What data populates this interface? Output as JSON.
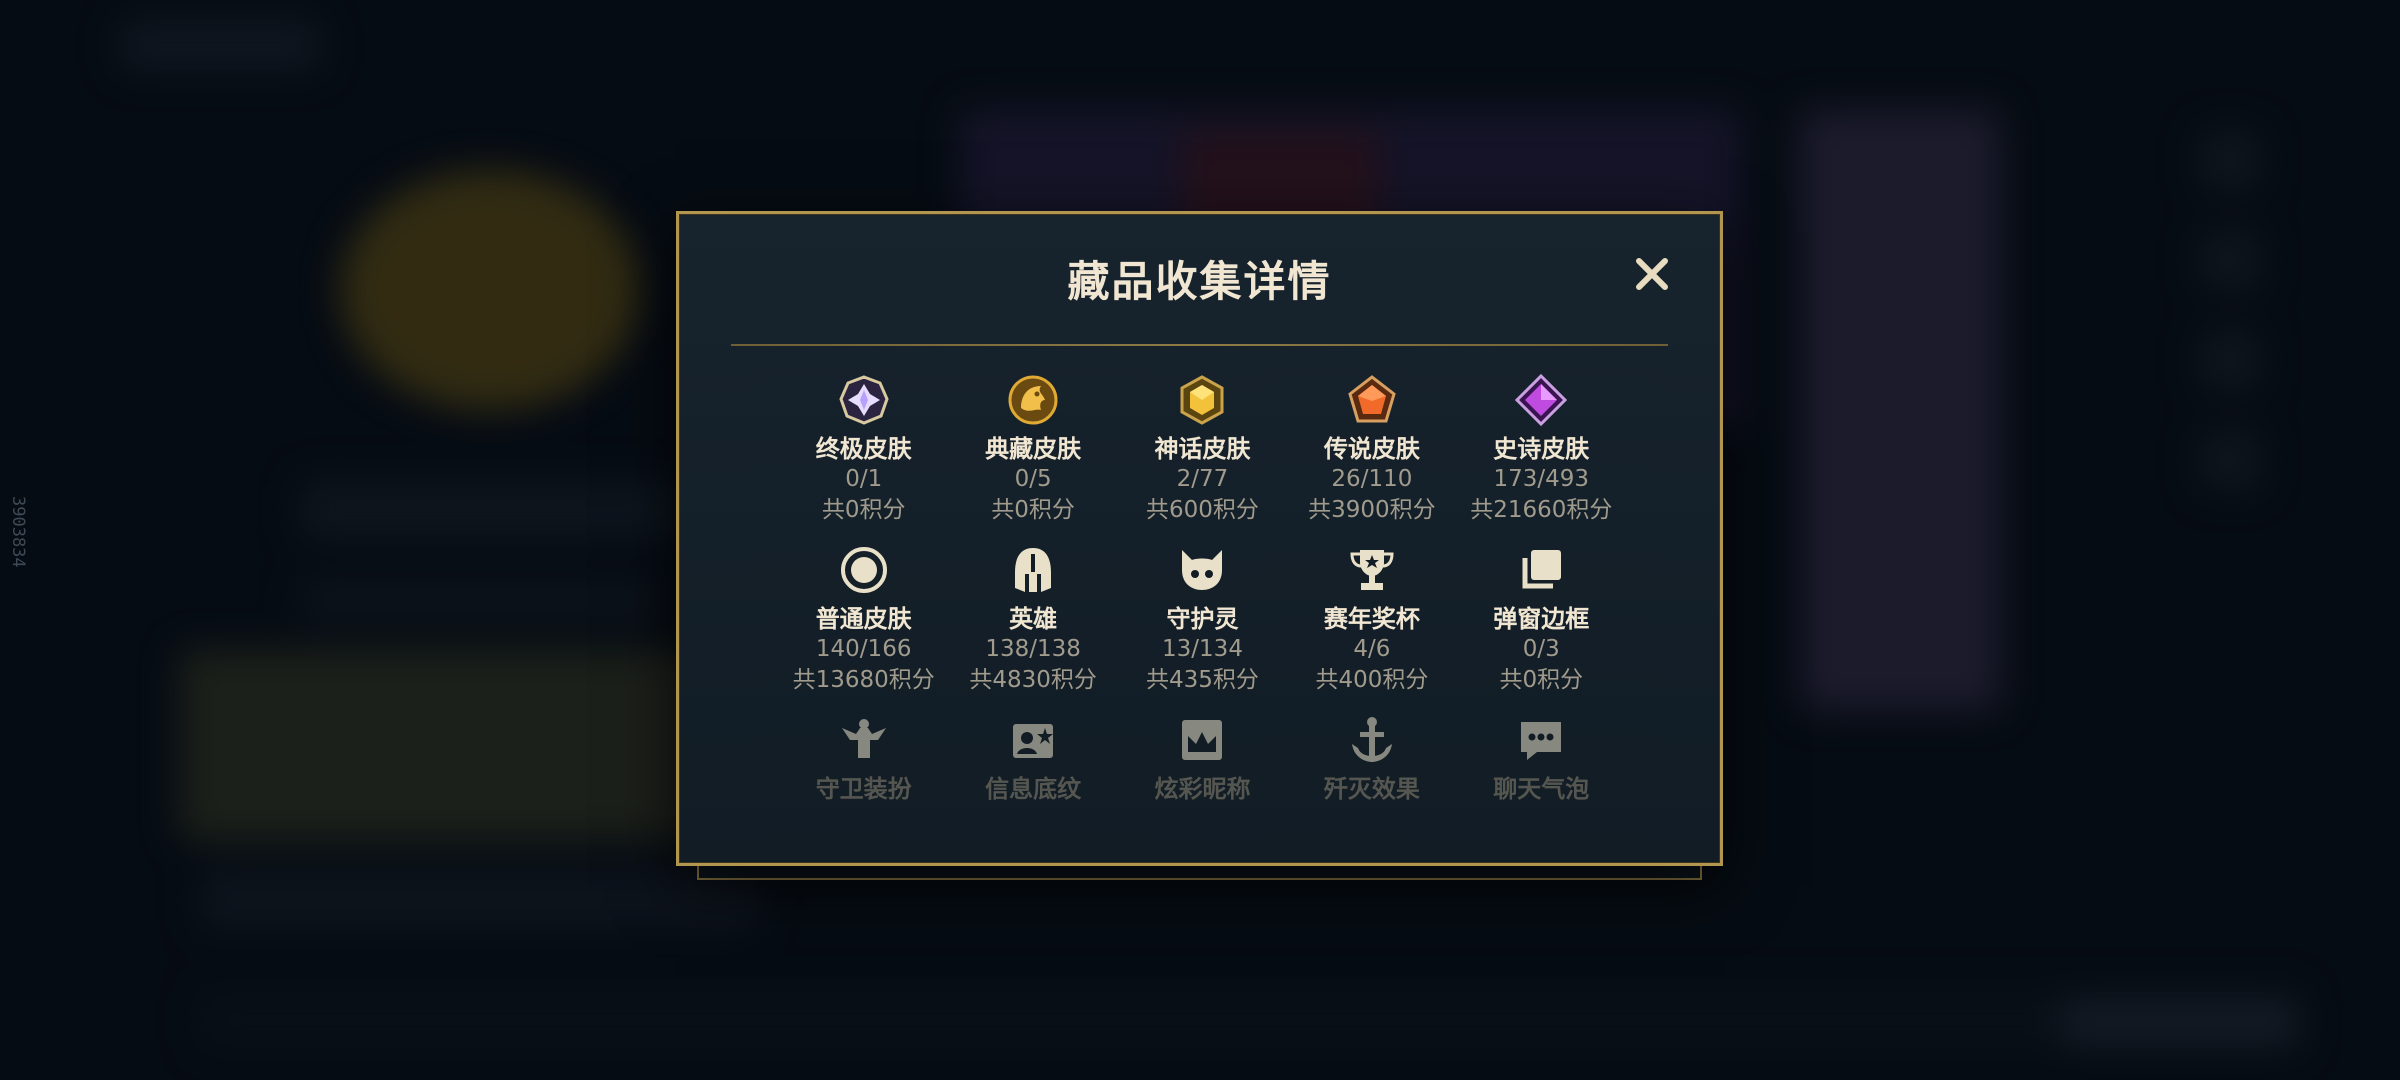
{
  "side_id": "3903834",
  "modal": {
    "title": "藏品收集详情",
    "close_icon": "close-icon"
  },
  "categories": [
    {
      "label": "终极皮肤",
      "count": "0/1",
      "points": "共0积分",
      "icon": "ultimate-skin-icon",
      "color": "#c9b8ff"
    },
    {
      "label": "典藏皮肤",
      "count": "0/5",
      "points": "共0积分",
      "icon": "prestige-skin-icon",
      "color": "#e0a934"
    },
    {
      "label": "神话皮肤",
      "count": "2/77",
      "points": "共600积分",
      "icon": "mythic-skin-icon",
      "color": "#f2c23a"
    },
    {
      "label": "传说皮肤",
      "count": "26/110",
      "points": "共3900积分",
      "icon": "legendary-skin-icon",
      "color": "#f26a2a"
    },
    {
      "label": "史诗皮肤",
      "count": "173/493",
      "points": "共21660积分",
      "icon": "epic-skin-icon",
      "color": "#c04be0"
    },
    {
      "label": "普通皮肤",
      "count": "140/166",
      "points": "共13680积分",
      "icon": "standard-skin-icon",
      "color": "#e8e0c8"
    },
    {
      "label": "英雄",
      "count": "138/138",
      "points": "共4830积分",
      "icon": "champion-helmet-icon",
      "color": "#e8e0c8"
    },
    {
      "label": "守护灵",
      "count": "13/134",
      "points": "共435积分",
      "icon": "little-legend-icon",
      "color": "#e8e0c8"
    },
    {
      "label": "赛年奖杯",
      "count": "4/6",
      "points": "共400积分",
      "icon": "trophy-icon",
      "color": "#e8e0c8"
    },
    {
      "label": "弹窗边框",
      "count": "0/3",
      "points": "共0积分",
      "icon": "frame-icon",
      "color": "#e8e0c8"
    },
    {
      "label": "守卫装扮",
      "icon": "ward-skin-icon",
      "color": "#e8e0c8"
    },
    {
      "label": "信息底纹",
      "icon": "banner-icon",
      "color": "#e8e0c8"
    },
    {
      "label": "炫彩昵称",
      "icon": "nickname-icon",
      "color": "#e8e0c8"
    },
    {
      "label": "歼灭效果",
      "icon": "finisher-icon",
      "color": "#e8e0c8"
    },
    {
      "label": "聊天气泡",
      "icon": "chat-bubble-icon",
      "color": "#e8e0c8"
    }
  ]
}
